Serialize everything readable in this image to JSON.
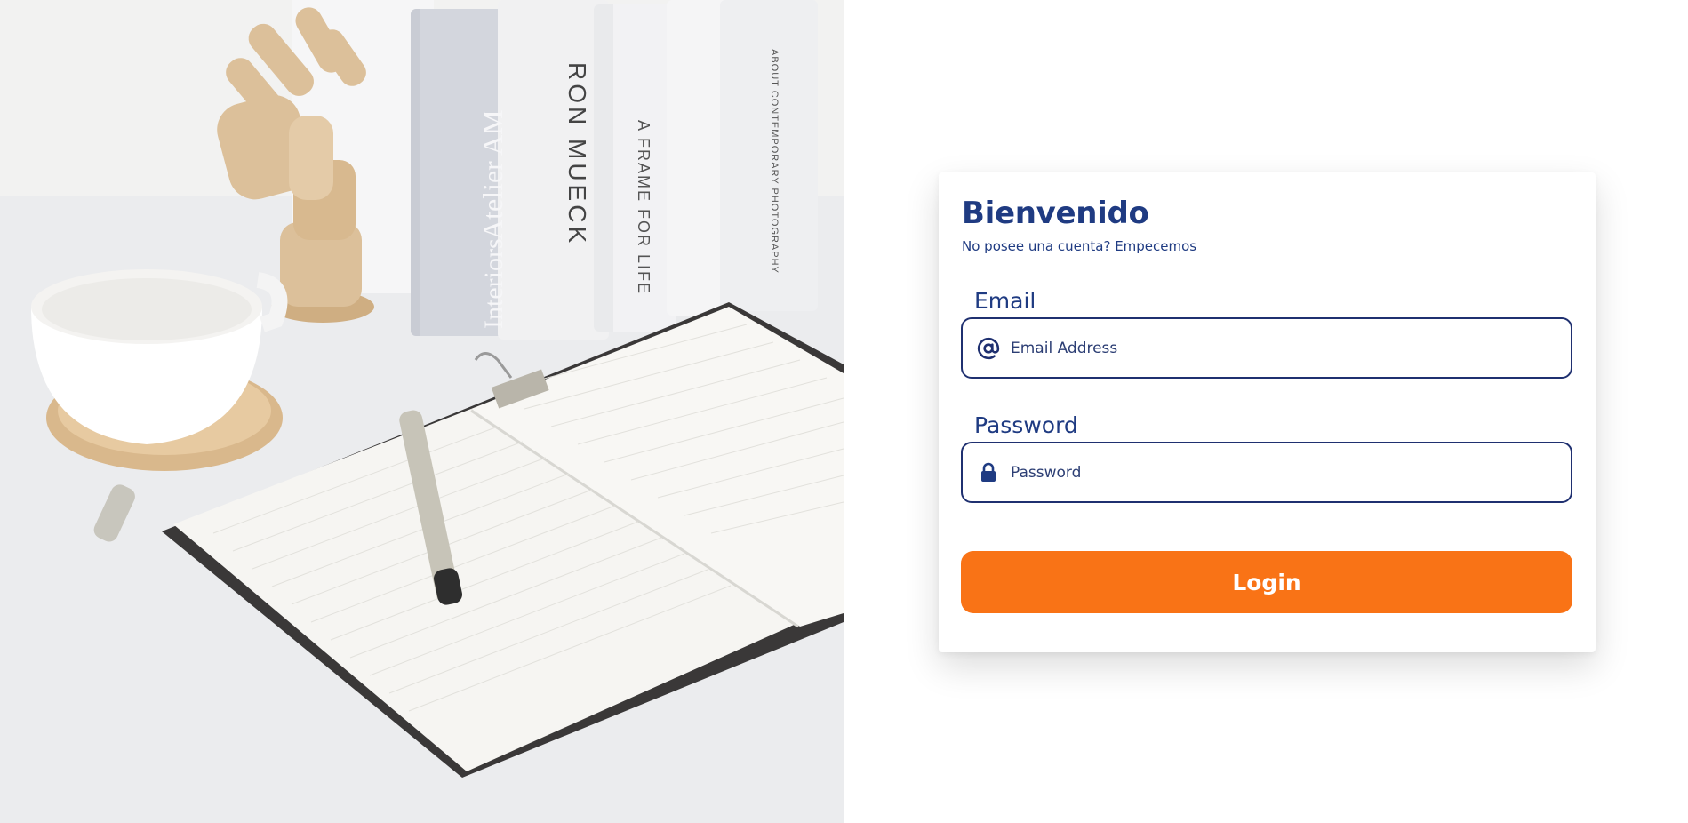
{
  "hero": {
    "book_spines": [
      "Interiors Atelier AM",
      "RON MUECK",
      "A FRAME FOR LIFE",
      "ABOUT CONTEMPORARY PHOTOGRAPHY"
    ]
  },
  "login": {
    "title": "Bienvenido",
    "subtitle_prefix": "No posee una cuenta?",
    "subtitle_link": "Empecemos",
    "email_label": "Email",
    "email_placeholder": "Email Address",
    "email_icon": "at-sign-icon",
    "password_label": "Password",
    "password_placeholder": "Password",
    "password_icon": "lock-icon",
    "button_label": "Login"
  },
  "colors": {
    "brand_blue": "#1f3b82",
    "field_border": "#1f3070",
    "accent_orange": "#f97316"
  }
}
